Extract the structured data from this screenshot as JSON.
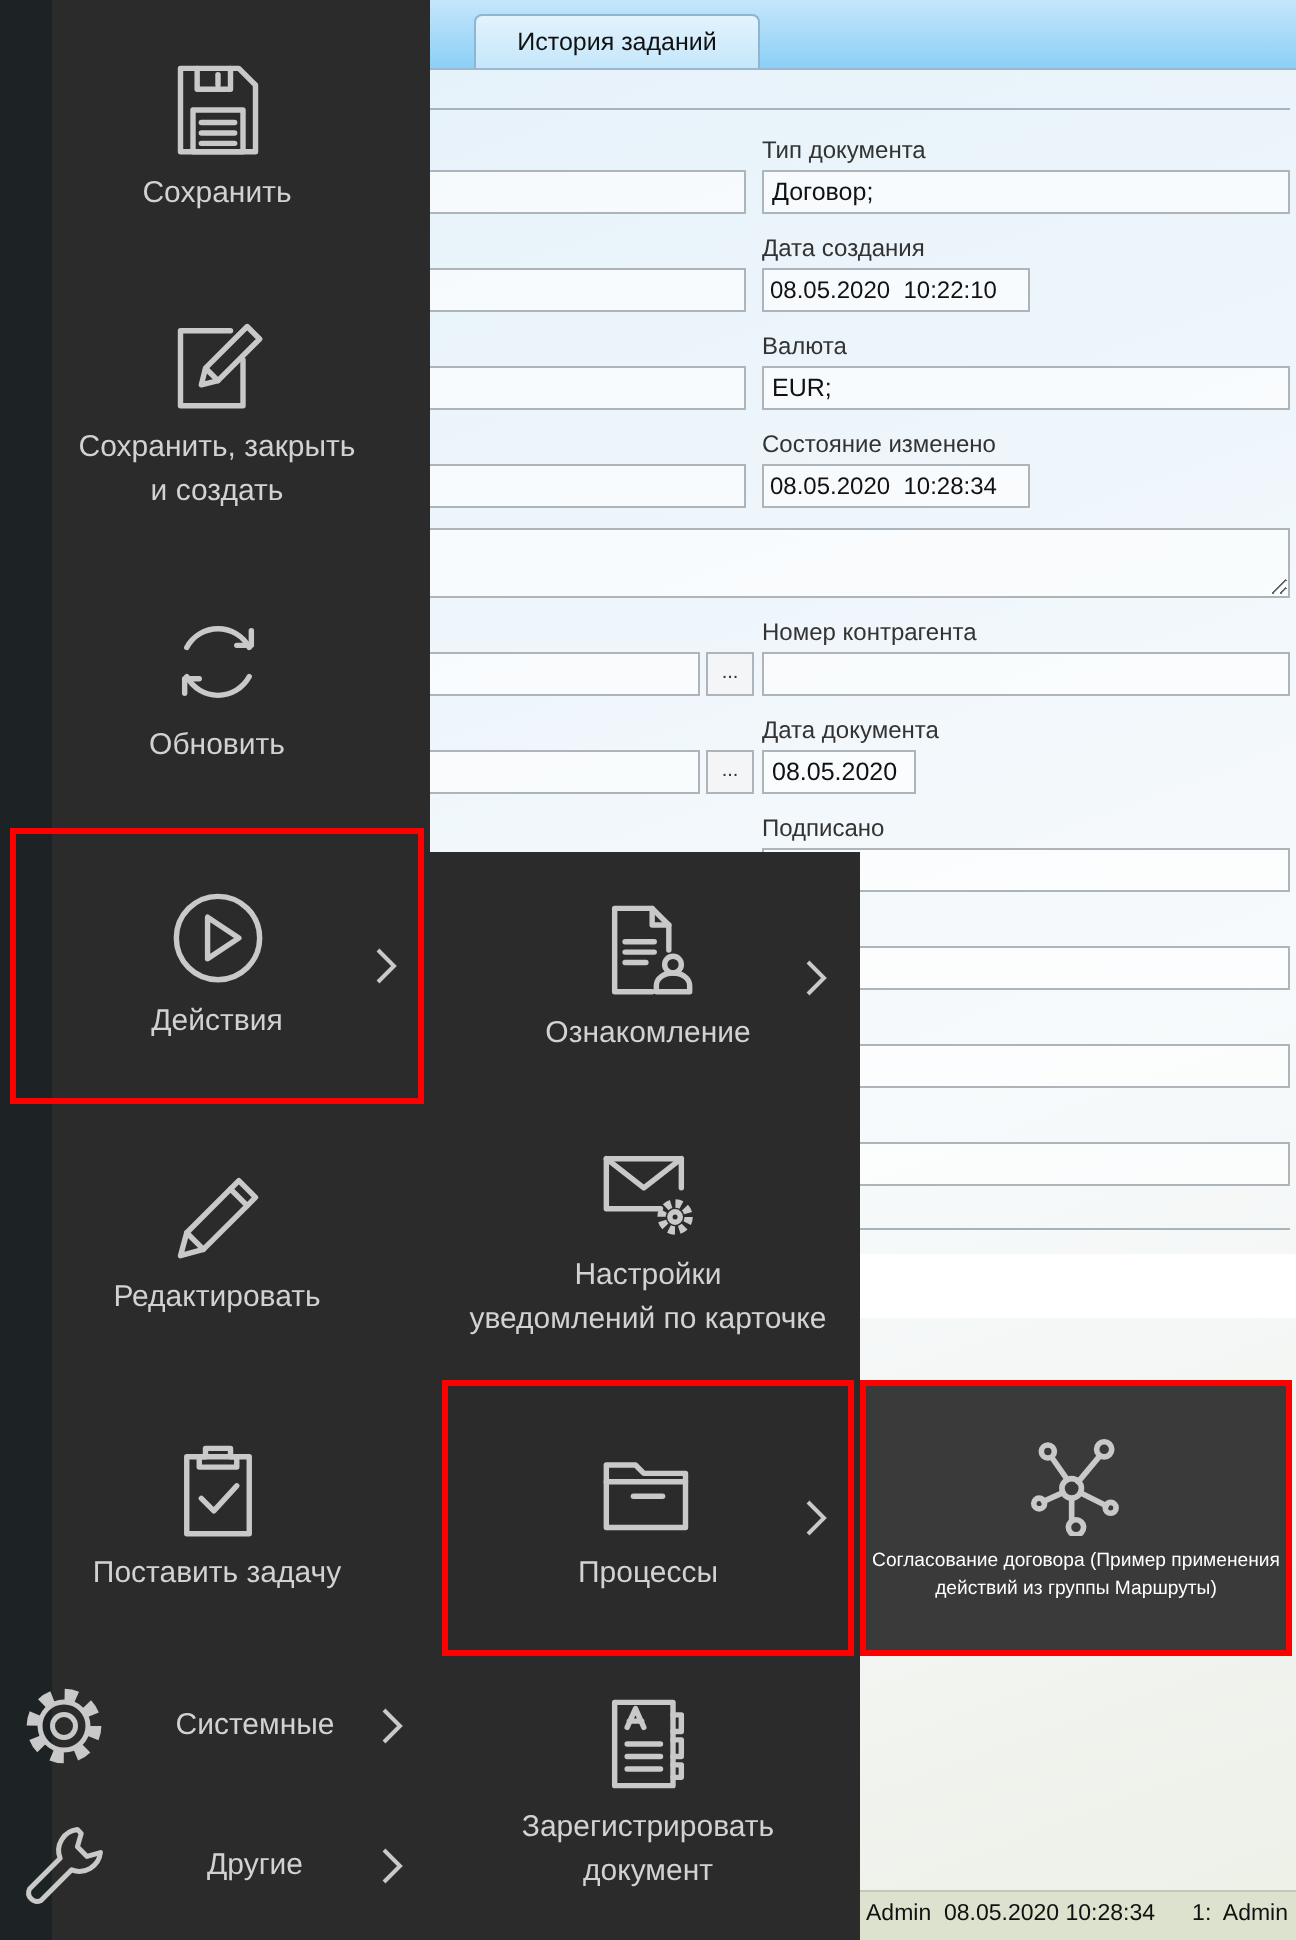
{
  "header": {
    "tabs": [
      {
        "label": "История заданий",
        "selected": true
      }
    ]
  },
  "form": {
    "rows": [
      {
        "kind": "pair",
        "left": {
          "kind": "field"
        },
        "right": {
          "label": "Тип документа",
          "value": "Договор;",
          "kind": "wide"
        }
      },
      {
        "kind": "pair",
        "left": {
          "kind": "field"
        },
        "right": {
          "label": "Дата создания",
          "value": "08.05.2020  10:22:10",
          "kind": "short"
        }
      },
      {
        "kind": "pair",
        "left": {
          "kind": "field"
        },
        "right": {
          "label": "Валюта",
          "value": "EUR;",
          "kind": "wide"
        }
      },
      {
        "kind": "pair",
        "left": {
          "kind": "field"
        },
        "right": {
          "label": "Состояние изменено",
          "value": "08.05.2020  10:28:34",
          "kind": "short"
        }
      },
      {
        "kind": "area"
      },
      {
        "kind": "pair",
        "left": {
          "kind": "lookup",
          "button": "..."
        },
        "right": {
          "label": "Номер контрагента",
          "kind": "wide"
        }
      },
      {
        "kind": "pair",
        "left": {
          "kind": "lookup",
          "button": "..."
        },
        "right": {
          "label": "Дата документа",
          "value": "08.05.2020",
          "kind": "tiny"
        }
      },
      {
        "kind": "pair",
        "right": {
          "label": "Подписано",
          "kind": "wide"
        }
      },
      {
        "kind": "full"
      },
      {
        "kind": "full"
      },
      {
        "kind": "full"
      }
    ]
  },
  "status_bar": {
    "items": [
      "Admin  08.05.2020 10:28:34",
      "1:  Admin"
    ]
  },
  "main_menu": {
    "items": [
      {
        "label": "Сохранить",
        "kind": "tile",
        "selected": false,
        "submenu": false
      },
      {
        "label": "Сохранить, закрыть\nи создать",
        "kind": "tile",
        "selected": false,
        "submenu": false
      },
      {
        "label": "Обновить",
        "kind": "tile",
        "selected": false,
        "submenu": false
      },
      {
        "label": "Действия",
        "kind": "tile",
        "selected": true,
        "submenu": true
      },
      {
        "label": "Редактировать",
        "kind": "tile",
        "selected": false,
        "submenu": false
      },
      {
        "label": "Поставить задачу",
        "kind": "tile",
        "selected": false,
        "submenu": false
      },
      {
        "label": "Системные",
        "kind": "row",
        "selected": false,
        "submenu": true
      },
      {
        "label": "Другие",
        "kind": "row",
        "selected": false,
        "submenu": true
      }
    ]
  },
  "actions_menu": {
    "items": [
      {
        "label": "Ознакомление",
        "kind": "tile",
        "selected": false,
        "submenu": true
      },
      {
        "label": "Настройки\nуведомлений по карточке",
        "kind": "tile",
        "selected": false,
        "submenu": false
      },
      {
        "label": "Процессы",
        "kind": "tile",
        "selected": true,
        "submenu": true
      },
      {
        "label": "Зарегистрировать\nдокумент",
        "kind": "tile",
        "selected": false,
        "submenu": false
      }
    ]
  },
  "processes_menu": {
    "items": [
      {
        "label": "Согласование договора (Пример применения\nдействий из группы Маршруты)",
        "selected": true
      }
    ]
  }
}
